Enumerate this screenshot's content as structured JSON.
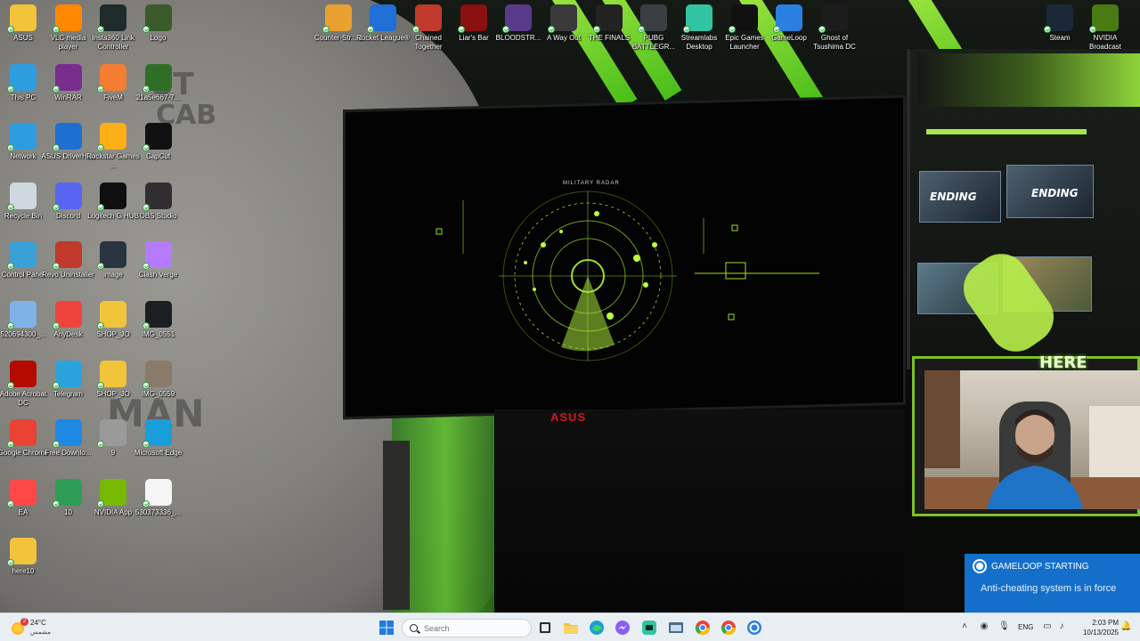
{
  "desktop": {
    "left_icons": [
      {
        "name": "asus-folder",
        "label": "ASUS",
        "icon": "folder-icon",
        "color": "#f2c43a"
      },
      {
        "name": "vlc",
        "label": "VLC media player",
        "icon": "vlc-cone-icon",
        "color": "#ff8800"
      },
      {
        "name": "insta360",
        "label": "Insta360 Link Controller",
        "icon": "insta360-icon",
        "color": "#1f2a2a"
      },
      {
        "name": "logo",
        "label": "Logo",
        "icon": "image-file-icon",
        "color": "#3a5a2a"
      },
      {
        "name": "this-pc",
        "label": "This PC",
        "icon": "monitor-icon",
        "color": "#2d9de0"
      },
      {
        "name": "winrar",
        "label": "WinRAR",
        "icon": "winrar-books-icon",
        "color": "#7a2c8c"
      },
      {
        "name": "fivem",
        "label": "FiveM",
        "icon": "fivem-icon",
        "color": "#f47d31"
      },
      {
        "name": "image-21a",
        "label": "21a5e667-7...",
        "icon": "image-file-icon",
        "color": "#2f6e27"
      },
      {
        "name": "network",
        "label": "Network",
        "icon": "network-icon",
        "color": "#2d9de0"
      },
      {
        "name": "asus-driverhub",
        "label": "ASUS DriverHub",
        "icon": "gear-icon",
        "color": "#1d6fd1"
      },
      {
        "name": "rockstar",
        "label": "Rockstar Games ...",
        "icon": "rockstar-icon",
        "color": "#fcaf17"
      },
      {
        "name": "capcut",
        "label": "CapCut",
        "icon": "capcut-icon",
        "color": "#111111"
      },
      {
        "name": "recycle-bin",
        "label": "Recycle Bin",
        "icon": "recycle-bin-icon",
        "color": "#cfd8e0"
      },
      {
        "name": "discord",
        "label": "Discord",
        "icon": "discord-icon",
        "color": "#5865f2"
      },
      {
        "name": "logitech-ghub",
        "label": "Logitech G HUB",
        "icon": "logitech-g-icon",
        "color": "#0f0f0f"
      },
      {
        "name": "obs",
        "label": "OBS Studio",
        "icon": "obs-icon",
        "color": "#302e31"
      },
      {
        "name": "control-panel",
        "label": "Control Panel",
        "icon": "control-panel-icon",
        "color": "#3aa0d8"
      },
      {
        "name": "revo",
        "label": "Revo Uninstaller",
        "icon": "revo-icon",
        "color": "#c0392b"
      },
      {
        "name": "image-person",
        "label": "image",
        "icon": "image-file-icon",
        "color": "#2a3340"
      },
      {
        "name": "clash-verge",
        "label": "Clash Verge",
        "icon": "cat-icon",
        "color": "#b57bff"
      },
      {
        "name": "file-520694300",
        "label": "520694300_...",
        "icon": "document-icon",
        "color": "#7fb3e8"
      },
      {
        "name": "anydesk",
        "label": "AnyDesk",
        "icon": "anydesk-icon",
        "color": "#ef443b"
      },
      {
        "name": "shop-jo-1",
        "label": "SHOP_JO",
        "icon": "folder-icon",
        "color": "#f2c43a"
      },
      {
        "name": "img-0551",
        "label": "IMG_0551",
        "icon": "image-file-icon",
        "color": "#1c1f22"
      },
      {
        "name": "acrobat",
        "label": "Adobe Acrobat DC",
        "icon": "acrobat-icon",
        "color": "#b30b00"
      },
      {
        "name": "telegram",
        "label": "Telegram",
        "icon": "telegram-icon",
        "color": "#2aa3dd"
      },
      {
        "name": "shop-jo-2",
        "label": "SHOP_JO",
        "icon": "folder-icon",
        "color": "#f2c43a"
      },
      {
        "name": "img-0559",
        "label": "IMG_0559",
        "icon": "image-file-icon",
        "color": "#8a7a6a"
      },
      {
        "name": "chrome",
        "label": "Google Chrome",
        "icon": "chrome-icon",
        "color": "#ea4335"
      },
      {
        "name": "fdm",
        "label": "Free Downlo...",
        "icon": "download-icon",
        "color": "#1e88e5"
      },
      {
        "name": "file-9",
        "label": "9",
        "icon": "image-file-icon",
        "color": "#9a9a9a"
      },
      {
        "name": "edge",
        "label": "Microsoft Edge",
        "icon": "edge-icon",
        "color": "#1a9ed9"
      },
      {
        "name": "ea",
        "label": "EA",
        "icon": "ea-icon",
        "color": "#ff4747"
      },
      {
        "name": "file-10",
        "label": "10",
        "icon": "image-file-icon",
        "color": "#2e9e56"
      },
      {
        "name": "nvidia-app",
        "label": "NVIDIA App",
        "icon": "nvidia-icon",
        "color": "#76b900"
      },
      {
        "name": "file-530373336",
        "label": "530373336_...",
        "icon": "document-icon",
        "color": "#f5f5f5"
      },
      {
        "name": "here10",
        "label": "here10",
        "icon": "folder-icon",
        "color": "#f2c43a"
      }
    ],
    "top_icons": [
      {
        "name": "cs2",
        "label": "Counter-Str... 2",
        "icon": "counter-strike-icon",
        "color": "#e8a030"
      },
      {
        "name": "rocket-league",
        "label": "Rocket League®",
        "icon": "rocket-league-icon",
        "color": "#1f6fd6"
      },
      {
        "name": "chained-together",
        "label": "Chained Together",
        "icon": "chained-together-icon",
        "color": "#c0392b"
      },
      {
        "name": "liars-bar",
        "label": "Liar's Bar",
        "icon": "liars-bar-icon",
        "color": "#8b1010"
      },
      {
        "name": "bloodstrike",
        "label": "BLOODSTR...",
        "icon": "bloodstrike-icon",
        "color": "#5a3a8a"
      },
      {
        "name": "a-way-out",
        "label": "A Way Out",
        "icon": "a-way-out-icon",
        "color": "#3a3a3a"
      },
      {
        "name": "the-finals",
        "label": "THE FINALS",
        "icon": "the-finals-icon",
        "color": "#222222"
      },
      {
        "name": "pubg",
        "label": "PUBG BATTLEGR...",
        "icon": "pubg-icon",
        "color": "#3a3f44"
      },
      {
        "name": "streamlabs",
        "label": "Streamlabs Desktop",
        "icon": "streamlabs-icon",
        "color": "#31c3a2"
      },
      {
        "name": "epic",
        "label": "Epic Games Launcher",
        "icon": "epic-games-icon",
        "color": "#111111"
      },
      {
        "name": "gameloop",
        "label": "GameLoop",
        "icon": "gameloop-icon",
        "color": "#2b7fe0"
      },
      {
        "name": "ghost-of-tsushima",
        "label": "Ghost of Tsushima DC",
        "icon": "ghost-of-tsushima-icon",
        "color": "#1c1c1c"
      },
      {
        "name": "steam",
        "label": "Steam",
        "icon": "steam-icon",
        "color": "#1b2838"
      },
      {
        "name": "nvidia-broadcast",
        "label": "NVIDIA Broadcast",
        "icon": "nvidia-broadcast-icon",
        "color": "#4a7a12"
      }
    ]
  },
  "wallpaper": {
    "radar_title": "MILITARY RADAR",
    "monitor_brand": "ASUS",
    "overlay_text": "HERE",
    "accent": "#6fd12a"
  },
  "notification": {
    "title": "GAMELOOP STARTING",
    "body": "Anti-cheating system is in force",
    "color": "#1678dc"
  },
  "taskbar": {
    "weather": {
      "temp": "24°C",
      "condition": "مشمس",
      "badge": "2"
    },
    "search_placeholder": "Search",
    "pinned": [
      {
        "name": "start-button",
        "icon": "windows-icon"
      },
      {
        "name": "task-view",
        "icon": "task-view-icon"
      },
      {
        "name": "file-explorer",
        "icon": "folder-icon"
      },
      {
        "name": "edge-taskbar",
        "icon": "edge-icon"
      },
      {
        "name": "messenger-taskbar",
        "icon": "messenger-icon"
      },
      {
        "name": "streamlabs-taskbar",
        "icon": "streamlabs-icon"
      },
      {
        "name": "control-panel-taskbar",
        "icon": "window-icon"
      },
      {
        "name": "chrome-taskbar",
        "icon": "chrome-icon"
      },
      {
        "name": "chrome-profile-taskbar",
        "icon": "chrome-icon"
      },
      {
        "name": "gameloop-taskbar",
        "icon": "gameloop-icon"
      }
    ],
    "tray": {
      "language": "ENG",
      "time": "2:03 PM",
      "date": "10/13/2025"
    }
  }
}
